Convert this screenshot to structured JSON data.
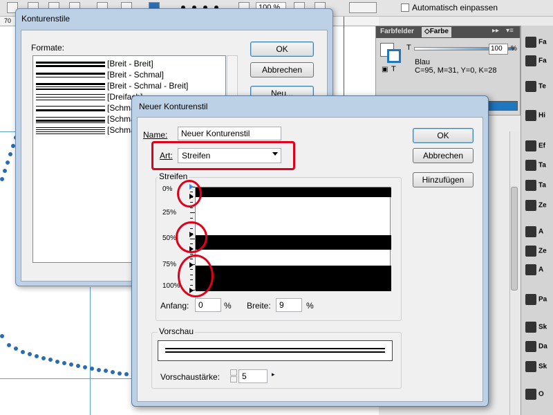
{
  "toolbar": {
    "zoom_value": "100 %",
    "auto_fit_label": "Automatisch einpassen"
  },
  "ruler": {
    "marks": [
      "70"
    ]
  },
  "color_panel": {
    "tabs": [
      "Farbfelder",
      "Farbe"
    ],
    "tint_value": "100",
    "tint_unit": "%",
    "tint_label": "T",
    "swatch_name": "Blau",
    "swatch_values": "C=95, M=31, Y=0, K=28",
    "accent_color": "#1f77c0"
  },
  "dock": {
    "items": [
      "Fa",
      "Fa",
      "Te",
      "Hi",
      "Ef",
      "Ta",
      "Ta",
      "Ze",
      "A",
      "Ze",
      "A",
      "Pa",
      "Sk",
      "Da",
      "Sk",
      "O"
    ]
  },
  "styles_dialog": {
    "title": "Konturenstile",
    "formats_label": "Formate:",
    "items": [
      {
        "name": "[Breit - Breit]",
        "pattern": "breit-breit"
      },
      {
        "name": "[Breit - Schmal]",
        "pattern": "breit-schmal"
      },
      {
        "name": "[Breit - Schmal - Breit]",
        "pattern": "breit-schmal-breit"
      },
      {
        "name": "[Dreifach]",
        "pattern": "dreifach"
      },
      {
        "name": "[Schmal",
        "pattern": "schmal-1"
      },
      {
        "name": "[Schmal",
        "pattern": "schmal-2"
      },
      {
        "name": "[Schmal",
        "pattern": "schmal-3"
      }
    ],
    "ok_label": "OK",
    "cancel_label": "Abbrechen",
    "new_label": "Neu..."
  },
  "new_dialog": {
    "title": "Neuer Konturenstil",
    "name_label": "Name:",
    "name_value": "Neuer Konturenstil",
    "art_label": "Art:",
    "art_value": "Streifen",
    "ok_label": "OK",
    "cancel_label": "Abbrechen",
    "add_label": "Hinzufügen",
    "stripes_group": "Streifen",
    "percent_labels": [
      "0%",
      "25%",
      "50%",
      "75%",
      "100%"
    ],
    "stripes": [
      {
        "start": 0,
        "width": 9
      },
      {
        "start": 46,
        "width": 14
      },
      {
        "start": 75,
        "width": 25
      }
    ],
    "start_label": "Anfang:",
    "start_value": "0",
    "width_label": "Breite:",
    "width_value": "9",
    "percent_unit": "%",
    "preview_group": "Vorschau",
    "preview_weight_label": "Vorschaustärke:",
    "preview_weight_value": "5",
    "highlight_color": "#e0001a"
  }
}
